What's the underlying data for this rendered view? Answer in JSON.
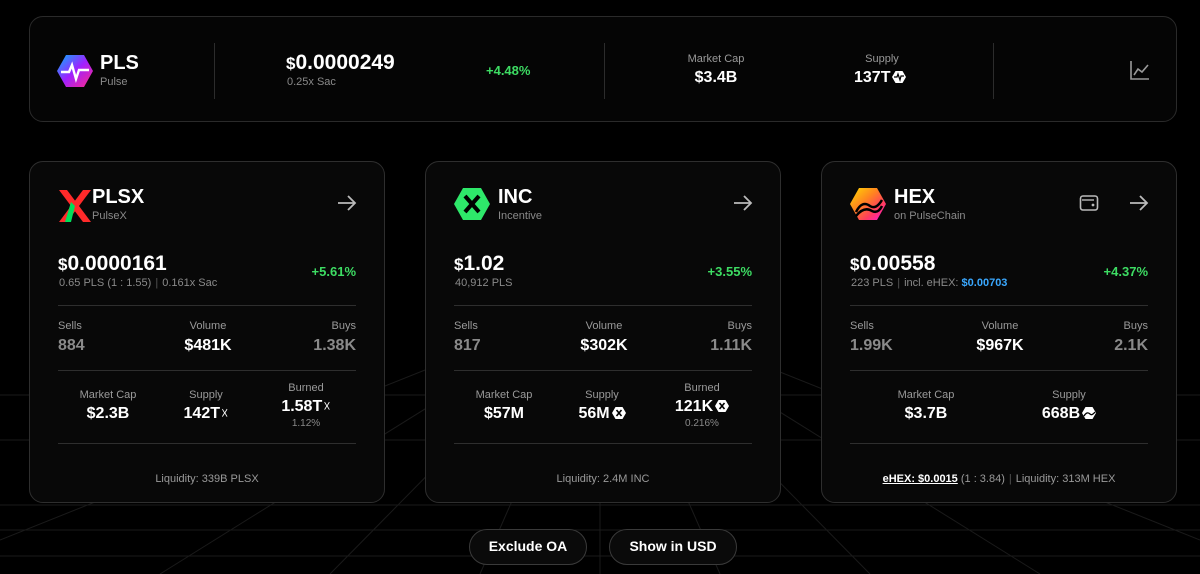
{
  "top": {
    "symbol": "PLS",
    "name": "Pulse",
    "price": "0.0000249",
    "price_sub": "0.25x Sac",
    "change": "+4.48%",
    "market_cap_label": "Market Cap",
    "market_cap": "$3.4B",
    "supply_label": "Supply",
    "supply": "137T",
    "chart_icon": "chart-line-icon"
  },
  "cards": [
    {
      "symbol": "PLSX",
      "name": "PulseX",
      "price": "0.0000161",
      "sub_a": "0.65 PLS (1 : 1.55)",
      "sub_b": "0.161x Sac",
      "change": "+5.61%",
      "sells_label": "Sells",
      "sells": "884",
      "volume_label": "Volume",
      "volume": "$481K",
      "buys_label": "Buys",
      "buys": "1.38K",
      "market_cap_label": "Market Cap",
      "market_cap": "$2.3B",
      "supply_label": "Supply",
      "supply": "142T",
      "burned_label": "Burned",
      "burned": "1.58T",
      "burned_pct": "1.12%",
      "liquidity": "Liquidity: 339B PLSX"
    },
    {
      "symbol": "INC",
      "name": "Incentive",
      "price": "1.02",
      "sub_a": "40,912 PLS",
      "change": "+3.55%",
      "sells_label": "Sells",
      "sells": "817",
      "volume_label": "Volume",
      "volume": "$302K",
      "buys_label": "Buys",
      "buys": "1.11K",
      "market_cap_label": "Market Cap",
      "market_cap": "$57M",
      "supply_label": "Supply",
      "supply": "56M",
      "burned_label": "Burned",
      "burned": "121K",
      "burned_pct": "0.216%",
      "liquidity": "Liquidity: 2.4M INC"
    },
    {
      "symbol": "HEX",
      "name": "on PulseChain",
      "price": "0.00558",
      "sub_a": "223 PLS",
      "sub_b_prefix": "incl. eHEX:",
      "sub_b_value": "$0.00703",
      "change": "+4.37%",
      "sells_label": "Sells",
      "sells": "1.99K",
      "volume_label": "Volume",
      "volume": "$967K",
      "buys_label": "Buys",
      "buys": "2.1K",
      "market_cap_label": "Market Cap",
      "market_cap": "$3.7B",
      "supply_label": "Supply",
      "supply": "668B",
      "ehex_link": "eHEX: $0.0015",
      "ehex_ratio": "(1 : 3.84)",
      "liquidity": "Liquidity: 313M HEX"
    }
  ],
  "buttons": {
    "exclude": "Exclude OA",
    "show_usd": "Show in USD"
  },
  "colors": {
    "positive": "#3ddc63",
    "link_blue": "#3aa8ff",
    "pulsex_red": "#ff2a2a"
  }
}
